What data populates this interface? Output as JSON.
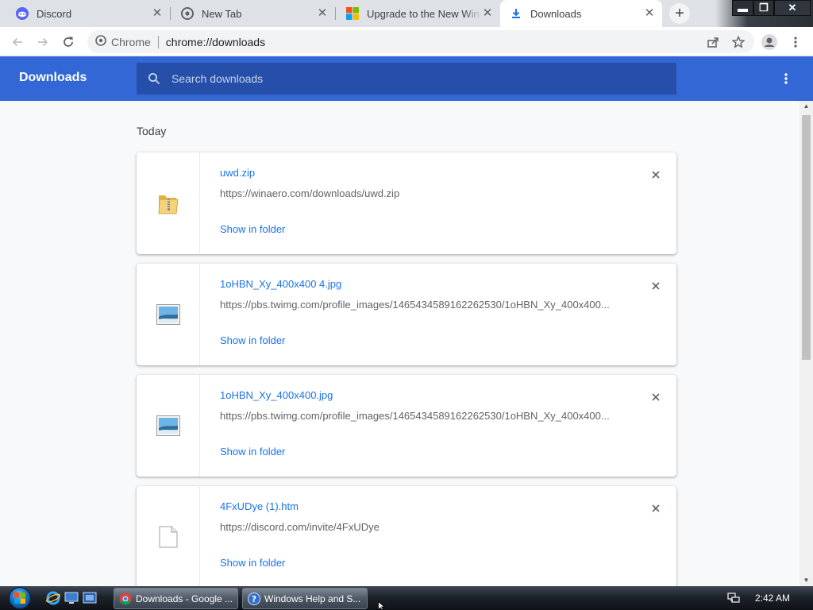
{
  "browser": {
    "tabs": [
      {
        "title": "Discord",
        "favicon": "discord-icon",
        "active": false
      },
      {
        "title": "New Tab",
        "favicon": "chrome-icon",
        "active": false
      },
      {
        "title": "Upgrade to the New Windows",
        "favicon": "microsoft-icon",
        "active": false
      },
      {
        "title": "Downloads",
        "favicon": "download-icon",
        "active": true
      }
    ],
    "close_glyph": "✕",
    "new_tab_glyph": "+",
    "window_controls": {
      "minimize": "▬",
      "restore": "❐",
      "close": "✕"
    },
    "toolbar": {
      "site_label": "Chrome",
      "url": "chrome://downloads"
    }
  },
  "downloads": {
    "header_title": "Downloads",
    "search_placeholder": "Search downloads",
    "section_label": "Today",
    "items": [
      {
        "file_name": "uwd.zip",
        "url": "https://winaero.com/downloads/uwd.zip",
        "action": "Show in folder",
        "icon": "zip-folder-icon"
      },
      {
        "file_name": "1oHBN_Xy_400x400 4.jpg",
        "url": "https://pbs.twimg.com/profile_images/1465434589162262530/1oHBN_Xy_400x400...",
        "action": "Show in folder",
        "icon": "image-file-icon"
      },
      {
        "file_name": "1oHBN_Xy_400x400.jpg",
        "url": "https://pbs.twimg.com/profile_images/1465434589162262530/1oHBN_Xy_400x400...",
        "action": "Show in folder",
        "icon": "image-file-icon"
      },
      {
        "file_name": "4FxUDye (1).htm",
        "url": "https://discord.com/invite/4FxUDye",
        "action": "Show in folder",
        "icon": "document-file-icon"
      }
    ]
  },
  "taskbar": {
    "tasks": [
      {
        "label": "Downloads - Google ...",
        "icon": "chrome-icon"
      },
      {
        "label": "Windows Help and S...",
        "icon": "help-icon"
      }
    ],
    "clock": "2:42 AM"
  },
  "colors": {
    "header_blue": "#3367d6",
    "search_blue": "#254fa8",
    "link_blue": "#1a73e8"
  }
}
